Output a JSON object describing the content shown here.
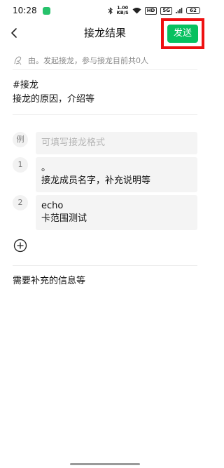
{
  "status_bar": {
    "time": "10:28",
    "net_speed_value": "1.00",
    "net_speed_unit": "KB/S",
    "hd_label": "HD",
    "signal_label": "5G",
    "battery": "62"
  },
  "navbar": {
    "title": "接龙结果",
    "send_label": "发送"
  },
  "creator": {
    "text": "由。发起接龙，参与接龙目前共0人"
  },
  "topic": {
    "line1": "#接龙",
    "line2": "接龙的原因，介绍等"
  },
  "example": {
    "marker": "例",
    "placeholder": "可填写接龙格式"
  },
  "entries": [
    {
      "number": "1",
      "line1": "。",
      "line2": "接龙成员名字，补充说明等"
    },
    {
      "number": "2",
      "line1": "echo",
      "line2": "卡范围测试"
    }
  ],
  "supplement": {
    "text": "需要补充的信息等"
  },
  "colors": {
    "accent": "#07c160",
    "highlight_box": "#ee1111"
  }
}
